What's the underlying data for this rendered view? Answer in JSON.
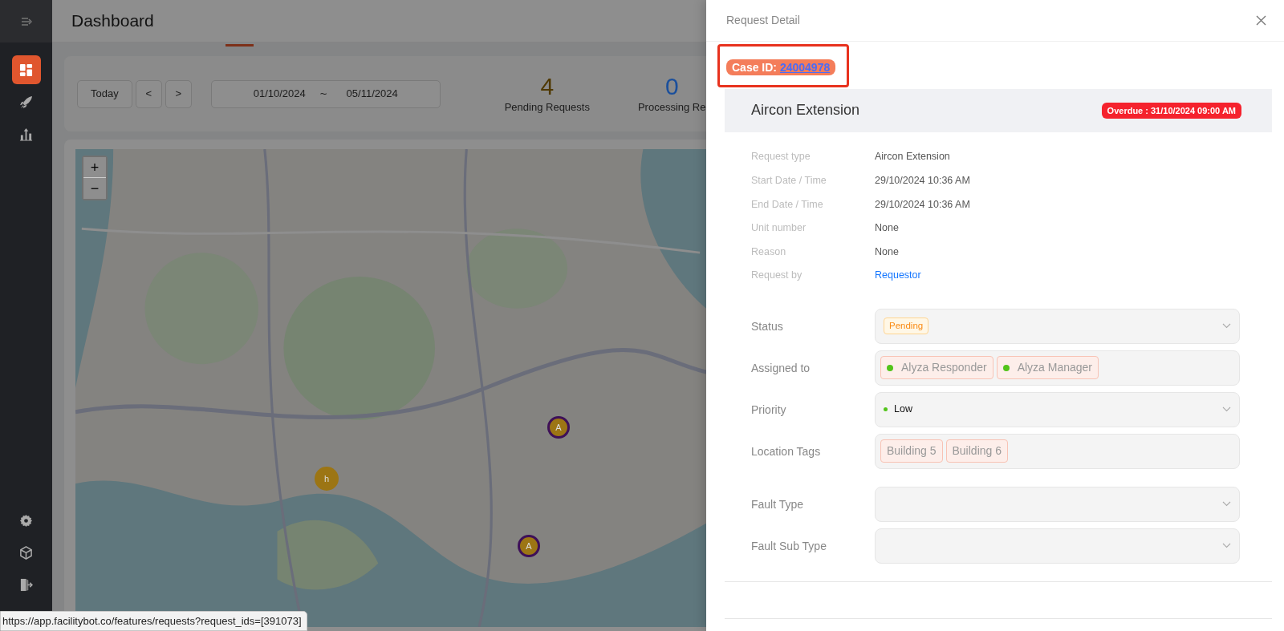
{
  "sidebar": {
    "items": [
      {
        "kind": "grid",
        "selected": true
      },
      {
        "kind": "rocket",
        "selected": false
      },
      {
        "kind": "chart",
        "selected": false
      },
      {
        "kind": "gear",
        "selected": false
      },
      {
        "kind": "cube",
        "selected": false
      },
      {
        "kind": "exit",
        "selected": false
      }
    ]
  },
  "page": {
    "title": "Dashboard"
  },
  "toolbar": {
    "today": "Today",
    "prev": "<",
    "next": ">",
    "date_start": "01/10/2024",
    "date_separator": "~",
    "date_end": "05/11/2024"
  },
  "stats": [
    {
      "value": "4",
      "label": "Pending Requests",
      "color": "#4f3800"
    },
    {
      "value": "0",
      "label": "Processing Re",
      "color": "#1a4f9c"
    }
  ],
  "map": {
    "zoom_in": "+",
    "zoom_out": "−",
    "markers": [
      {
        "label": "A",
        "kind": "ring"
      },
      {
        "label": "h",
        "kind": "plain"
      },
      {
        "label": "A",
        "kind": "ring"
      }
    ]
  },
  "status_url": "https://app.facilitybot.co/features/requests?request_ids=[391073]",
  "drawer": {
    "title": "Request Detail",
    "case": {
      "label": "Case ID:",
      "value": "24004978",
      "highlighted": true
    },
    "request_title": "Aircon Extension",
    "overdue": "Overdue : 31/10/2024 09:00 AM",
    "details": [
      {
        "label": "Request type",
        "value": "Aircon Extension",
        "kind": "text"
      },
      {
        "label": "Start Date / Time",
        "value": "29/10/2024 10:36 AM",
        "kind": "text"
      },
      {
        "label": "End Date / Time",
        "value": "29/10/2024 10:36 AM",
        "kind": "text"
      },
      {
        "label": "Unit number",
        "value": "None",
        "kind": "text"
      },
      {
        "label": "Reason",
        "value": "None",
        "kind": "text"
      },
      {
        "label": "Request by",
        "value": "Requestor",
        "kind": "link"
      }
    ],
    "fields": [
      {
        "label": "Status",
        "kind": "badge",
        "value": "Pending"
      },
      {
        "label": "Assigned to",
        "kind": "tags",
        "tags": [
          {
            "text": "Alyza Responder",
            "color": "#52c41a"
          },
          {
            "text": "Alyza Manager",
            "color": "#52c41a"
          }
        ]
      },
      {
        "label": "Priority",
        "kind": "dot",
        "value": "Low",
        "color": "#52c41a"
      },
      {
        "label": "Location Tags",
        "kind": "tags",
        "tags": [
          {
            "text": "Building 5"
          },
          {
            "text": "Building 6"
          }
        ]
      },
      {
        "label": "Fault Type",
        "kind": "select"
      },
      {
        "label": "Fault Sub Type",
        "kind": "select"
      }
    ]
  }
}
